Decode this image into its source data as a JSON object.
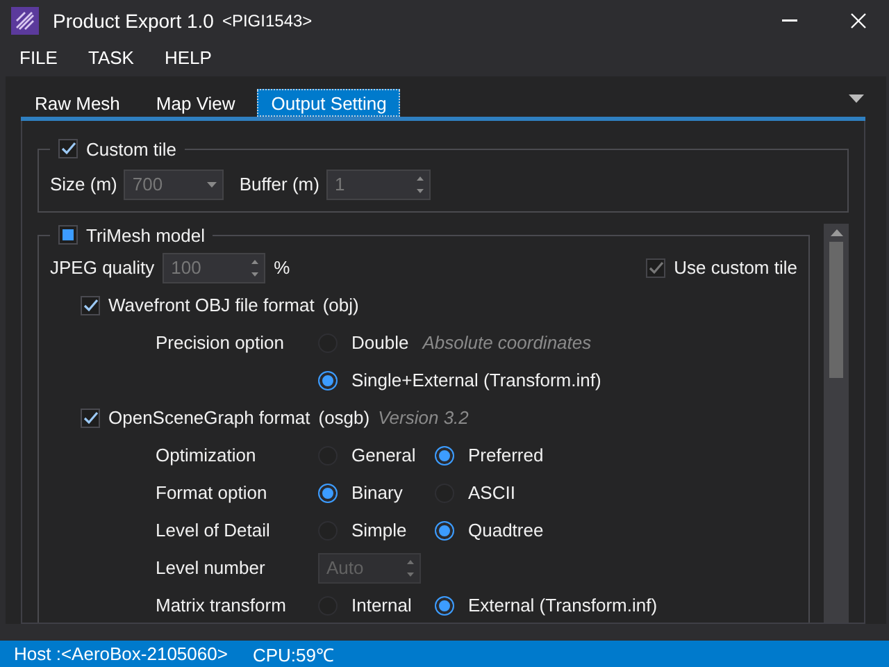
{
  "window": {
    "title": "Product Export 1.0",
    "subtitle": "<PIGI1543>"
  },
  "menu": [
    "FILE",
    "TASK",
    "HELP"
  ],
  "tabs": [
    {
      "label": "Raw Mesh",
      "selected": false
    },
    {
      "label": "Map View",
      "selected": false
    },
    {
      "label": "Output Setting",
      "selected": true
    }
  ],
  "custom_tile": {
    "label": "Custom tile",
    "checked": true,
    "fields": [
      {
        "label": "Size (m)",
        "kind": "dropdown",
        "value": "700"
      },
      {
        "label": "Buffer (m)",
        "kind": "spinner",
        "value": "1"
      }
    ]
  },
  "trimesh": {
    "label": "TriMesh model",
    "indeterminate": true,
    "jpeg": {
      "label": "JPEG quality",
      "value": "100",
      "unit": "%"
    },
    "use_custom_tile": {
      "label": "Use custom tile",
      "checked": true,
      "disabled": true
    },
    "formats": [
      {
        "label": "Wavefront OBJ file format",
        "ext": "(obj)",
        "checked": true,
        "rows": [
          {
            "label": "Precision option",
            "kind": "radio",
            "choices": [
              {
                "label": "Double",
                "note": "Absolute coordinates",
                "selected": false
              },
              {
                "label": "Single+External (Transform.inf)",
                "selected": true
              }
            ]
          }
        ]
      },
      {
        "label": "OpenSceneGraph format",
        "ext": "(osgb)",
        "note": "Version 3.2",
        "checked": true,
        "rows": [
          {
            "label": "Optimization",
            "kind": "radio",
            "choices": [
              {
                "label": "General",
                "selected": false
              },
              {
                "label": "Preferred",
                "selected": true
              }
            ]
          },
          {
            "label": "Format option",
            "kind": "radio",
            "choices": [
              {
                "label": "Binary",
                "selected": true
              },
              {
                "label": "ASCII",
                "selected": false
              }
            ]
          },
          {
            "label": "Level of Detail",
            "kind": "radio",
            "choices": [
              {
                "label": "Simple",
                "selected": false
              },
              {
                "label": "Quadtree",
                "selected": true
              }
            ]
          },
          {
            "label": "Level number",
            "kind": "spinner",
            "value": "Auto",
            "disabled": true
          },
          {
            "label": "Matrix transform",
            "kind": "radio",
            "choices": [
              {
                "label": "Internal",
                "selected": false
              },
              {
                "label": "External (Transform.inf)",
                "selected": true
              }
            ]
          }
        ]
      }
    ]
  },
  "status_bar": {
    "host": "Host :<AeroBox-2105060>",
    "cpu": "CPU:59℃"
  }
}
